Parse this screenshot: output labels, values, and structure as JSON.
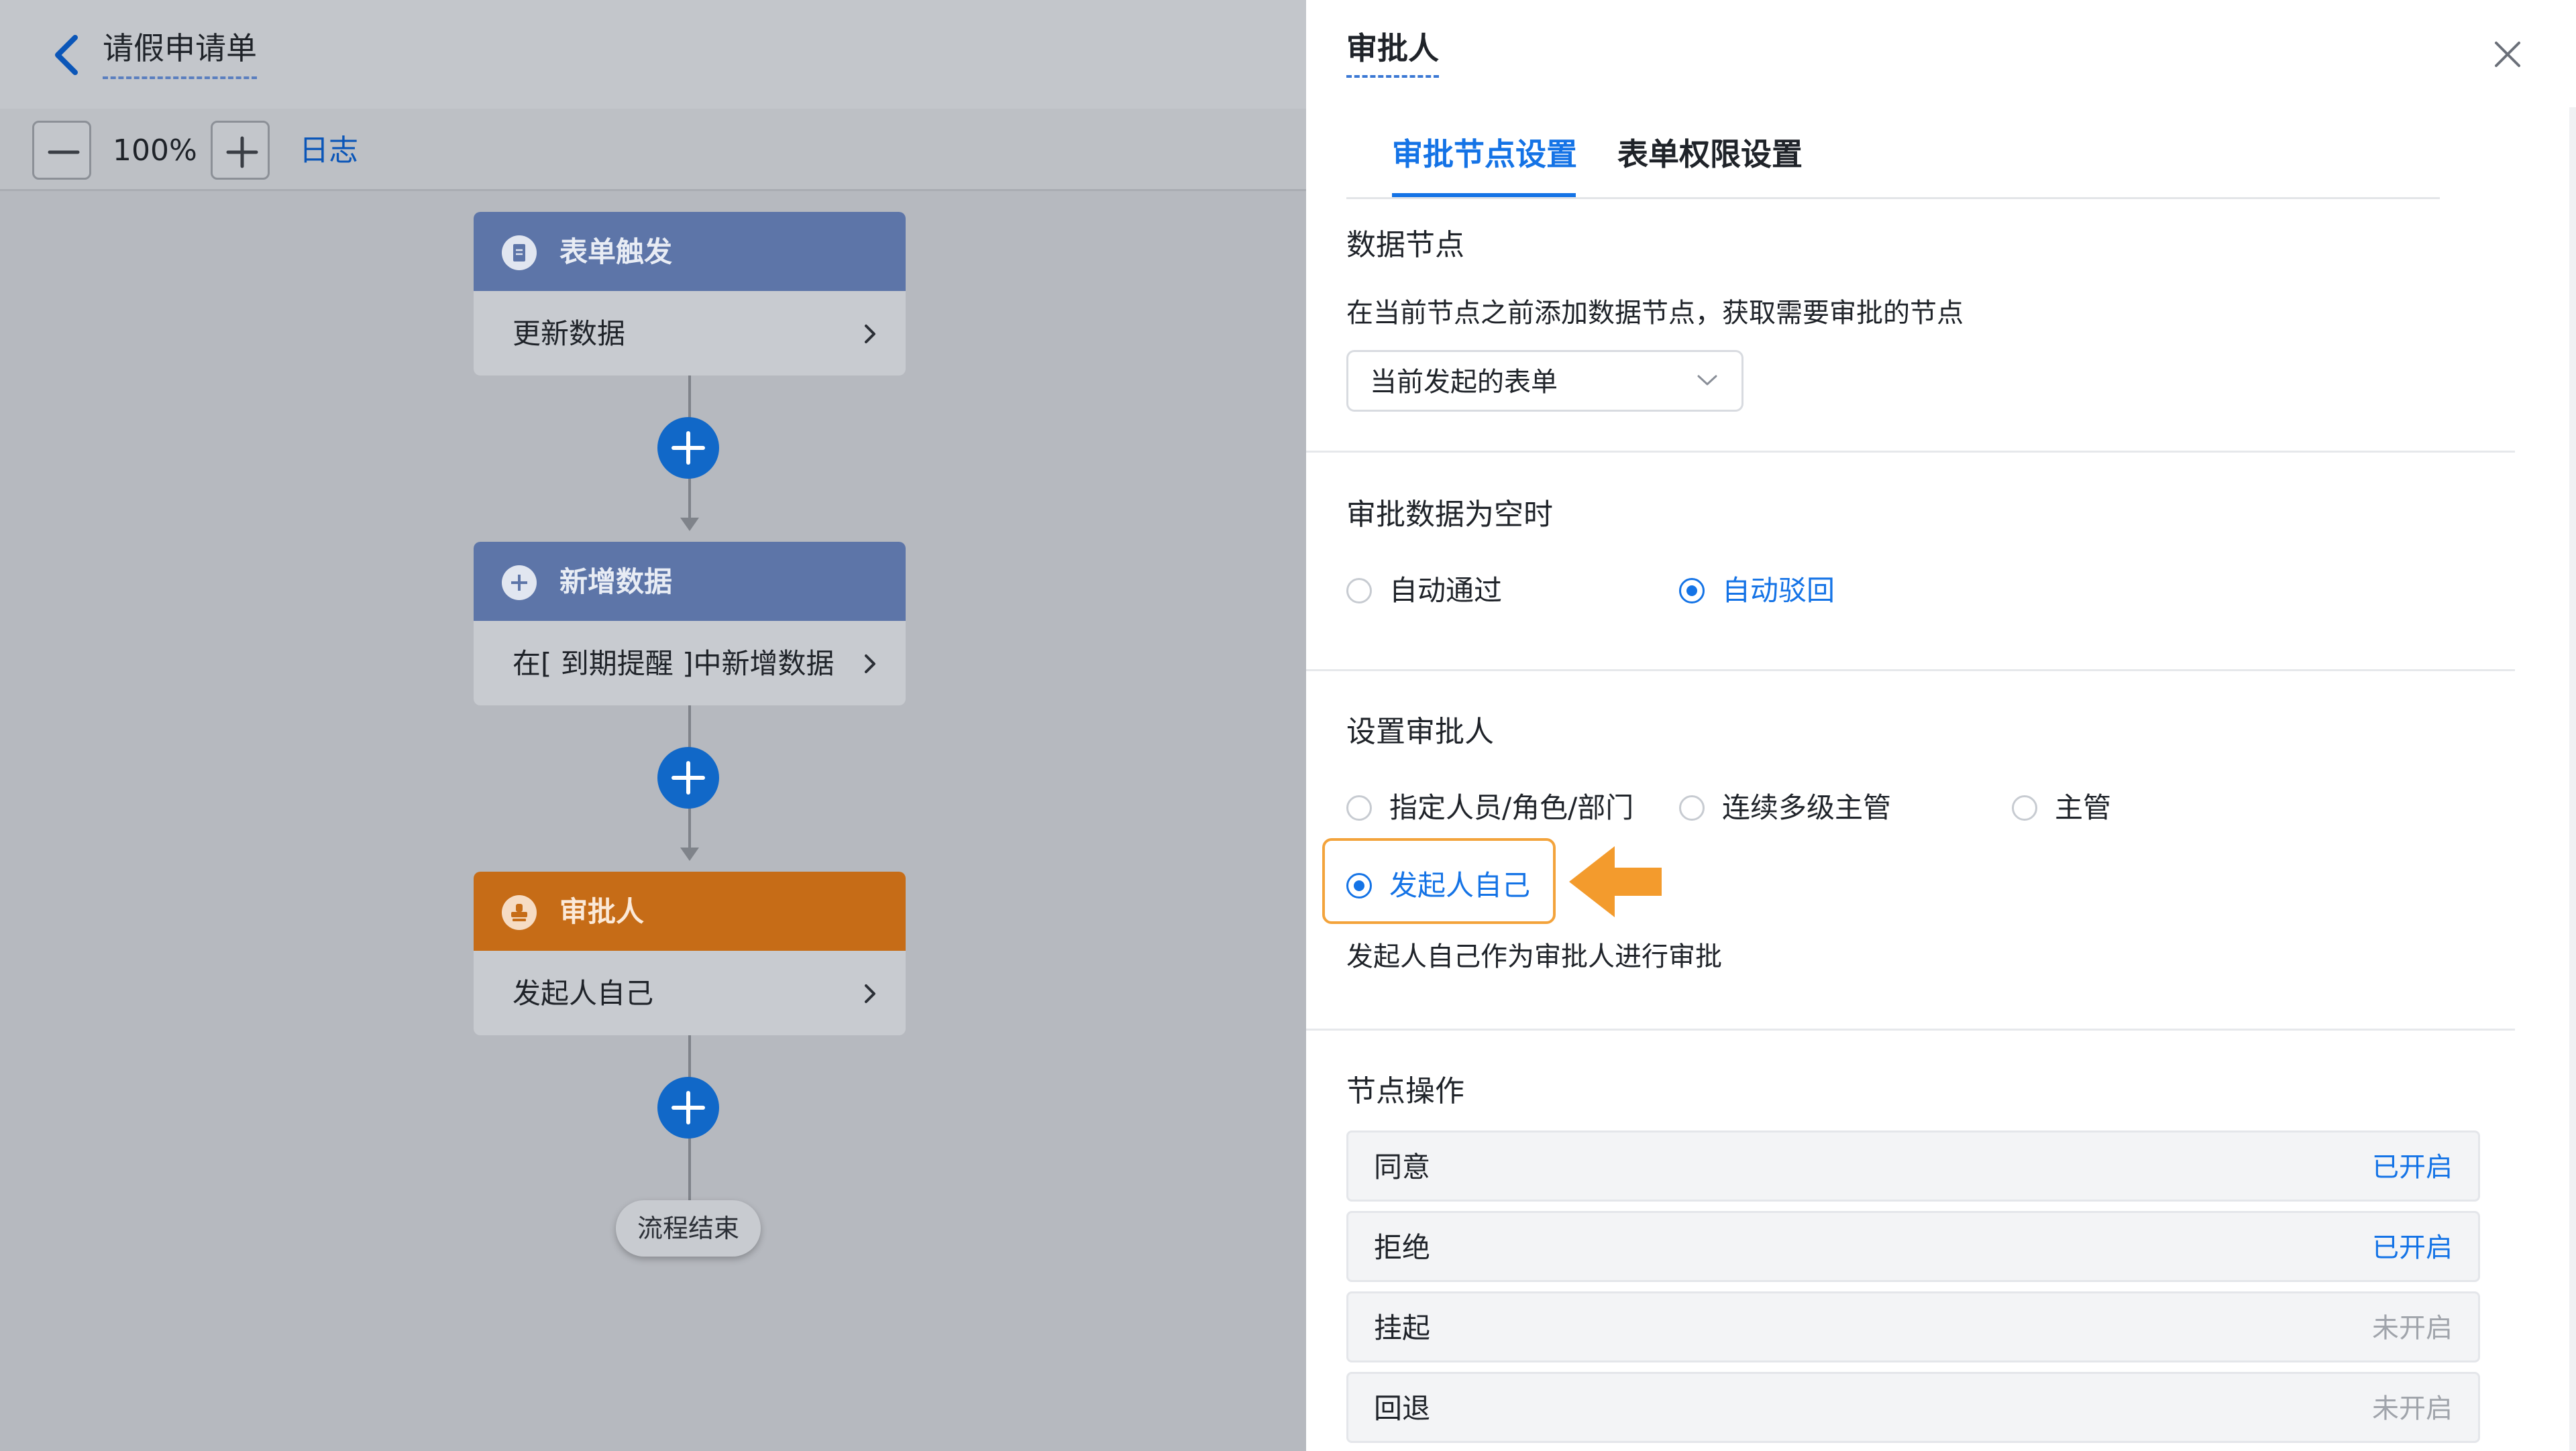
{
  "header": {
    "title": "请假申请单"
  },
  "toolbar": {
    "zoom": "100%",
    "log_label": "日志"
  },
  "flow": {
    "nodes": [
      {
        "title": "表单触发",
        "body": "更新数据",
        "color": "#5d75a8"
      },
      {
        "title": "新增数据",
        "body": "在[ 到期提醒 ]中新增数据",
        "color": "#5d75a8"
      },
      {
        "title": "审批人",
        "body": "发起人自己",
        "color": "#c66c17"
      }
    ],
    "end_label": "流程结束"
  },
  "panel": {
    "title": "审批人",
    "tabs": [
      {
        "label": "审批节点设置",
        "active": true
      },
      {
        "label": "表单权限设置",
        "active": false
      }
    ],
    "data_node": {
      "title": "数据节点",
      "description": "在当前节点之前添加数据节点，获取需要审批的节点",
      "select_value": "当前发起的表单"
    },
    "empty_data": {
      "title": "审批数据为空时",
      "options": [
        {
          "label": "自动通过",
          "checked": false
        },
        {
          "label": "自动驳回",
          "checked": true
        }
      ]
    },
    "approver": {
      "title": "设置审批人",
      "options": [
        {
          "label": "指定人员/角色/部门",
          "checked": false
        },
        {
          "label": "连续多级主管",
          "checked": false
        },
        {
          "label": "主管",
          "checked": false
        },
        {
          "label": "发起人自己",
          "checked": true
        }
      ],
      "hint": "发起人自己作为审批人进行审批"
    },
    "operations": {
      "title": "节点操作",
      "items": [
        {
          "label": "同意",
          "status": "已开启",
          "enabled": true
        },
        {
          "label": "拒绝",
          "status": "已开启",
          "enabled": true
        },
        {
          "label": "挂起",
          "status": "未开启",
          "enabled": false
        },
        {
          "label": "回退",
          "status": "未开启",
          "enabled": false
        }
      ]
    }
  },
  "colors": {
    "accent": "#1473e6",
    "highlight": "#f3a33b",
    "approver_node": "#c66c17",
    "flow_node": "#5d75a8"
  },
  "icons": [
    "chevron-left-icon",
    "minus-icon",
    "plus-icon",
    "document-icon",
    "add-circle-icon",
    "stamp-icon",
    "chevron-right-icon",
    "close-icon",
    "chevron-down-icon",
    "arrow-left-icon"
  ]
}
